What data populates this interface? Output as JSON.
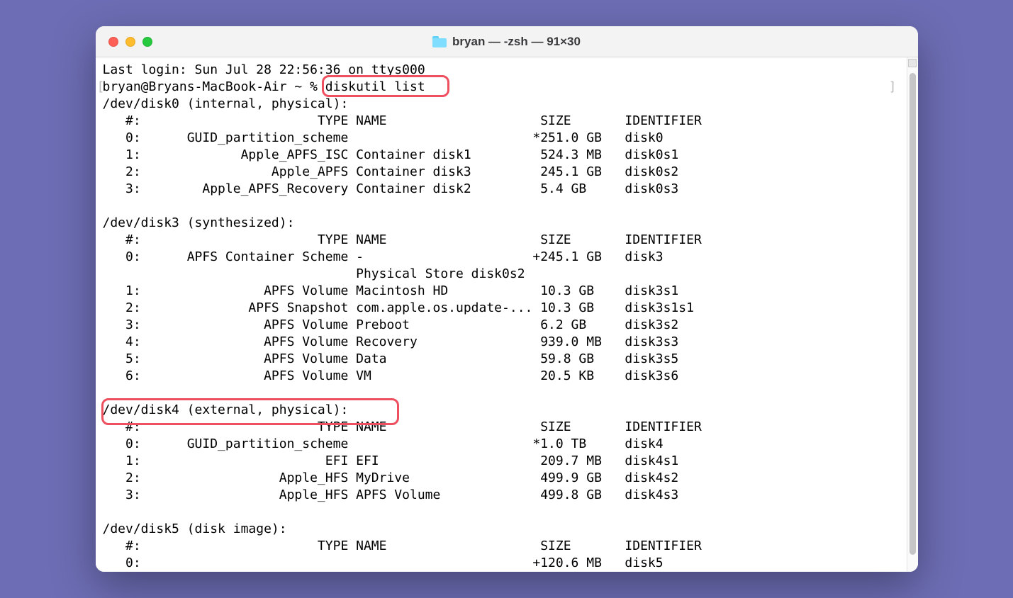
{
  "window": {
    "title": "bryan — -zsh — 91×30"
  },
  "terminal": {
    "last_login": "Last login: Sun Jul 28 22:56:36 on ttys000",
    "prompt": "bryan@Bryans-MacBook-Air ~ % ",
    "command": "diskutil list",
    "sections": [
      {
        "header": "/dev/disk0 (internal, physical):",
        "col_header": "   #:                       TYPE NAME                    SIZE       IDENTIFIER",
        "rows": [
          "   0:      GUID_partition_scheme                        *251.0 GB   disk0",
          "   1:             Apple_APFS_ISC Container disk1         524.3 MB   disk0s1",
          "   2:                 Apple_APFS Container disk3         245.1 GB   disk0s2",
          "   3:        Apple_APFS_Recovery Container disk2         5.4 GB     disk0s3"
        ]
      },
      {
        "header": "/dev/disk3 (synthesized):",
        "col_header": "   #:                       TYPE NAME                    SIZE       IDENTIFIER",
        "rows": [
          "   0:      APFS Container Scheme -                      +245.1 GB   disk3",
          "                                 Physical Store disk0s2",
          "   1:                APFS Volume Macintosh HD            10.3 GB    disk3s1",
          "   2:              APFS Snapshot com.apple.os.update-... 10.3 GB    disk3s1s1",
          "   3:                APFS Volume Preboot                 6.2 GB     disk3s2",
          "   4:                APFS Volume Recovery                939.0 MB   disk3s3",
          "   5:                APFS Volume Data                    59.8 GB    disk3s5",
          "   6:                APFS Volume VM                      20.5 KB    disk3s6"
        ]
      },
      {
        "header": "/dev/disk4 (external, physical):",
        "col_header": "   #:                       TYPE NAME                    SIZE       IDENTIFIER",
        "rows": [
          "   0:      GUID_partition_scheme                        *1.0 TB     disk4",
          "   1:                        EFI EFI                     209.7 MB   disk4s1",
          "   2:                  Apple_HFS MyDrive                 499.9 GB   disk4s2",
          "   3:                  Apple_HFS APFS Volume             499.8 GB   disk4s3"
        ]
      },
      {
        "header": "/dev/disk5 (disk image):",
        "col_header": "   #:                       TYPE NAME                    SIZE       IDENTIFIER",
        "rows": [
          "   0:                                                   +120.6 MB   disk5"
        ]
      }
    ]
  }
}
